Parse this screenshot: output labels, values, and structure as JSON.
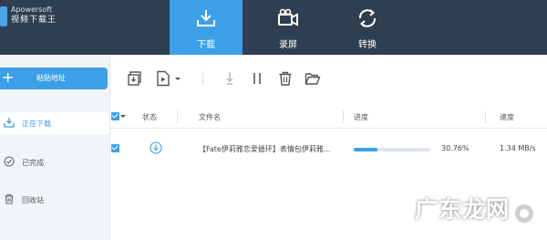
{
  "app": {
    "name": "Apowersoft",
    "subtitle": "视频下载王"
  },
  "tabs": [
    {
      "label": "下载",
      "icon": "download-tray-icon",
      "active": true
    },
    {
      "label": "录屏",
      "icon": "video-camera-icon",
      "active": false
    },
    {
      "label": "转换",
      "icon": "convert-arrows-icon",
      "active": false
    }
  ],
  "toolbar": {
    "add_button_label": "粘贴地址"
  },
  "sidebar": {
    "items": [
      {
        "label": "正在下载",
        "icon": "download-icon",
        "active": true
      },
      {
        "label": "已完成",
        "icon": "check-circle-icon",
        "active": false
      },
      {
        "label": "回收站",
        "icon": "trash-icon",
        "active": false
      }
    ]
  },
  "table": {
    "columns": [
      "状态",
      "文件名",
      "进度",
      "速度"
    ],
    "rows": [
      {
        "filename": "【Fate伊莉雅恋爱循环】表情包伊莉雅...",
        "progress_text": "30.76%",
        "progress_value": 0.3076,
        "speed": "1.34 MB/s",
        "checked": true
      }
    ]
  },
  "watermark": {
    "text": "广东龙网"
  },
  "colors": {
    "accent": "#3ca0e8",
    "topbar": "#2f3e50",
    "sidebar": "#f2f5f8"
  }
}
